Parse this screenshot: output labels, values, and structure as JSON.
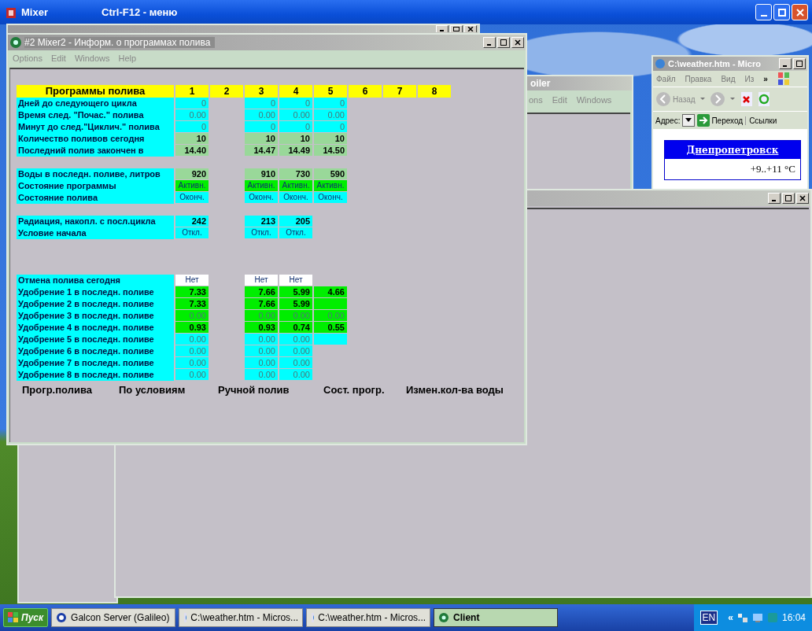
{
  "mixer": {
    "title": "Mixer",
    "hint": "Ctrl-F12 - меню"
  },
  "controller_window": {
    "title": "oiler",
    "menu": [
      "ons",
      "Edit",
      "Windows"
    ]
  },
  "browser_window": {
    "title": "C:\\weather.htm - Micro",
    "menu": [
      "Файл",
      "Правка",
      "Вид",
      "Из"
    ],
    "more": "»",
    "back": "Назад",
    "address_label": "Адрес:",
    "go": "Переход",
    "links": "Ссылки",
    "city": "Днепропетровск",
    "temperature": "+9..+11 °C"
  },
  "main_window": {
    "title": "#2 Mixer2 - Информ. о программах полива",
    "menu": [
      "Options",
      "Edit",
      "Windows",
      "Help"
    ],
    "table": {
      "title": "Программы полива",
      "columns": [
        "1",
        "2",
        "3",
        "4",
        "5",
        "6",
        "7",
        "8"
      ],
      "sections": [
        {
          "rows": [
            {
              "label": "Дней до следующего цикла",
              "kind": "number",
              "cells": [
                {
                  "value": "0",
                  "color": "#00ffff",
                  "faded": true
                },
                null,
                {
                  "value": "0",
                  "color": "#00ffff",
                  "faded": true
                },
                {
                  "value": "0",
                  "color": "#00ffff",
                  "faded": true
                },
                {
                  "value": "0",
                  "color": "#00ffff",
                  "faded": true
                }
              ]
            },
            {
              "label": "Время след. \"Почас.\" полива",
              "kind": "number",
              "cells": [
                {
                  "value": "0.00",
                  "color": "#00ffff",
                  "faded": true
                },
                null,
                {
                  "value": "0.00",
                  "color": "#00ffff",
                  "faded": true
                },
                {
                  "value": "0.00",
                  "color": "#00ffff",
                  "faded": true
                },
                {
                  "value": "0.00",
                  "color": "#00ffff",
                  "faded": true
                }
              ]
            },
            {
              "label": "Минут до след.\"Циклич.\" полива",
              "kind": "number",
              "cells": [
                {
                  "value": "0",
                  "color": "#00ffff",
                  "faded": true
                },
                null,
                {
                  "value": "0",
                  "color": "#00ffff",
                  "faded": true
                },
                {
                  "value": "0",
                  "color": "#00ffff",
                  "faded": true
                },
                {
                  "value": "0",
                  "color": "#00ffff",
                  "faded": true
                }
              ]
            },
            {
              "label": "Количество поливов сегодня",
              "kind": "number",
              "cells": [
                {
                  "value": "10",
                  "color": "#99d899",
                  "faded": false
                },
                null,
                {
                  "value": "10",
                  "color": "#99d899",
                  "faded": false
                },
                {
                  "value": "10",
                  "color": "#99d899",
                  "faded": false
                },
                {
                  "value": "10",
                  "color": "#99d899",
                  "faded": false
                }
              ]
            },
            {
              "label": "Последний полив закончен в",
              "kind": "number",
              "cells": [
                {
                  "value": "14.40",
                  "color": "#99d899",
                  "faded": false
                },
                null,
                {
                  "value": "14.47",
                  "color": "#99d899",
                  "faded": false
                },
                {
                  "value": "14.49",
                  "color": "#99d899",
                  "faded": false
                },
                {
                  "value": "14.50",
                  "color": "#99d899",
                  "faded": false
                }
              ]
            }
          ]
        },
        {
          "rows": [
            {
              "label": "Воды в последн. поливе,  литров",
              "kind": "number",
              "cells": [
                {
                  "value": "920",
                  "color": "#99d899",
                  "faded": false
                },
                null,
                {
                  "value": "910",
                  "color": "#99d899",
                  "faded": false
                },
                {
                  "value": "730",
                  "color": "#99d899",
                  "faded": false
                },
                {
                  "value": "590",
                  "color": "#99d899",
                  "faded": false
                }
              ]
            },
            {
              "label": "Состояние программы",
              "kind": "status",
              "cells": [
                {
                  "value": "Активн.",
                  "color": "#00ee00",
                  "faded": false
                },
                null,
                {
                  "value": "Активн.",
                  "color": "#00ee00",
                  "faded": false
                },
                {
                  "value": "Активн.",
                  "color": "#00ee00",
                  "faded": false
                },
                {
                  "value": "Активн.",
                  "color": "#00ee00",
                  "faded": false
                }
              ]
            },
            {
              "label": "Состояние полива",
              "kind": "status",
              "cells": [
                {
                  "value": "Оконч.",
                  "color": "#00ffff",
                  "faded": false
                },
                null,
                {
                  "value": "Оконч.",
                  "color": "#00ffff",
                  "faded": false
                },
                {
                  "value": "Оконч.",
                  "color": "#00ffff",
                  "faded": false
                },
                {
                  "value": "Оконч.",
                  "color": "#00ffff",
                  "faded": false
                }
              ]
            }
          ]
        },
        {
          "rows": [
            {
              "label": "Радиация, накопл. с посл.цикла",
              "kind": "number",
              "cells": [
                {
                  "value": "242",
                  "color": "#00ffff",
                  "faded": false
                },
                null,
                {
                  "value": "213",
                  "color": "#00ffff",
                  "faded": false
                },
                {
                  "value": "205",
                  "color": "#00ffff",
                  "faded": false
                },
                null
              ]
            },
            {
              "label": "Условие начала",
              "kind": "status",
              "cells": [
                {
                  "value": "Откл.",
                  "color": "#00ffff",
                  "faded": false
                },
                null,
                {
                  "value": "Откл.",
                  "color": "#00ffff",
                  "faded": false
                },
                {
                  "value": "Откл.",
                  "color": "#00ffff",
                  "faded": false
                },
                null
              ]
            }
          ]
        },
        {
          "rows": [
            {
              "label": "Отмена полива сегодня",
              "kind": "status",
              "cells": [
                {
                  "value": "Нет",
                  "color": "#ffffff",
                  "faded": false
                },
                null,
                {
                  "value": "Нет",
                  "color": "#ffffff",
                  "faded": false
                },
                {
                  "value": "Нет",
                  "color": "#ffffff",
                  "faded": false
                },
                null
              ]
            },
            {
              "label": "Удобрение 1 в последн. поливе",
              "kind": "number",
              "cells": [
                {
                  "value": "7.33",
                  "color": "#00ee00",
                  "faded": false
                },
                null,
                {
                  "value": "7.66",
                  "color": "#00ee00",
                  "faded": false
                },
                {
                  "value": "5.99",
                  "color": "#00ee00",
                  "faded": false
                },
                {
                  "value": "4.66",
                  "color": "#00ee00",
                  "faded": false
                }
              ]
            },
            {
              "label": "Удобрение 2 в последн. поливе",
              "kind": "number",
              "cells": [
                {
                  "value": "7.33",
                  "color": "#00ee00",
                  "faded": false
                },
                null,
                {
                  "value": "7.66",
                  "color": "#00ee00",
                  "faded": false
                },
                {
                  "value": "5.99",
                  "color": "#00ee00",
                  "faded": false
                },
                {
                  "color": "#00ee00"
                }
              ]
            },
            {
              "label": "Удобрение 3 в последн. поливе",
              "kind": "number",
              "cells": [
                {
                  "value": "0.00",
                  "color": "#00ee00",
                  "faded": true
                },
                null,
                {
                  "value": "0.00",
                  "color": "#00ee00",
                  "faded": true
                },
                {
                  "value": "0.00",
                  "color": "#00ee00",
                  "faded": true
                },
                {
                  "value": "0.00",
                  "color": "#00ee00",
                  "faded": true
                }
              ]
            },
            {
              "label": "Удобрение 4 в последн. поливе",
              "kind": "number",
              "cells": [
                {
                  "value": "0.93",
                  "color": "#00ee00",
                  "faded": false
                },
                null,
                {
                  "value": "0.93",
                  "color": "#00ee00",
                  "faded": false
                },
                {
                  "value": "0.74",
                  "color": "#00ee00",
                  "faded": false
                },
                {
                  "value": "0.55",
                  "color": "#00ee00",
                  "faded": false
                }
              ]
            },
            {
              "label": "Удобрение 5 в последн. поливе",
              "kind": "number",
              "cells": [
                {
                  "value": "0.00",
                  "color": "#00ffff",
                  "faded": true
                },
                null,
                {
                  "value": "0.00",
                  "color": "#00ffff",
                  "faded": true
                },
                {
                  "value": "0.00",
                  "color": "#00ffff",
                  "faded": true
                },
                {
                  "color": "#00ffff"
                }
              ]
            },
            {
              "label": "Удобрение 6 в последн. поливе",
              "kind": "number",
              "cells": [
                {
                  "value": "0.00",
                  "color": "#00ffff",
                  "faded": true
                },
                null,
                {
                  "value": "0.00",
                  "color": "#00ffff",
                  "faded": true
                },
                {
                  "value": "0.00",
                  "color": "#00ffff",
                  "faded": true
                },
                null
              ]
            },
            {
              "label": "Удобрение 7 в последн. поливе",
              "kind": "number",
              "cells": [
                {
                  "value": "0.00",
                  "color": "#00ffff",
                  "faded": true
                },
                null,
                {
                  "value": "0.00",
                  "color": "#00ffff",
                  "faded": true
                },
                {
                  "value": "0.00",
                  "color": "#00ffff",
                  "faded": true
                },
                null
              ]
            },
            {
              "label": "Удобрение 8 в последн. поливе",
              "kind": "number",
              "cells": [
                {
                  "value": "0.00",
                  "color": "#00ffff",
                  "faded": true
                },
                null,
                {
                  "value": "0.00",
                  "color": "#00ffff",
                  "faded": true
                },
                {
                  "value": "0.00",
                  "color": "#00ffff",
                  "faded": true
                },
                null
              ]
            }
          ]
        }
      ]
    },
    "footer_buttons": [
      "Прогр.полива",
      "По условиям",
      "Ручной полив",
      "Сост. прогр.",
      "Измен.кол-ва воды"
    ]
  },
  "taskbar": {
    "start": "Пуск",
    "items": [
      {
        "label": "Galcon Server (Galileo)",
        "kind": "server",
        "selected": false
      },
      {
        "label": "C:\\weather.htm - Micros...",
        "kind": "browser",
        "selected": false
      },
      {
        "label": "C:\\weather.htm - Micros...",
        "kind": "browser",
        "selected": false
      },
      {
        "label": "Client",
        "kind": "client",
        "selected": true
      }
    ],
    "language": "EN",
    "expand": "«",
    "clock": "16:04"
  }
}
